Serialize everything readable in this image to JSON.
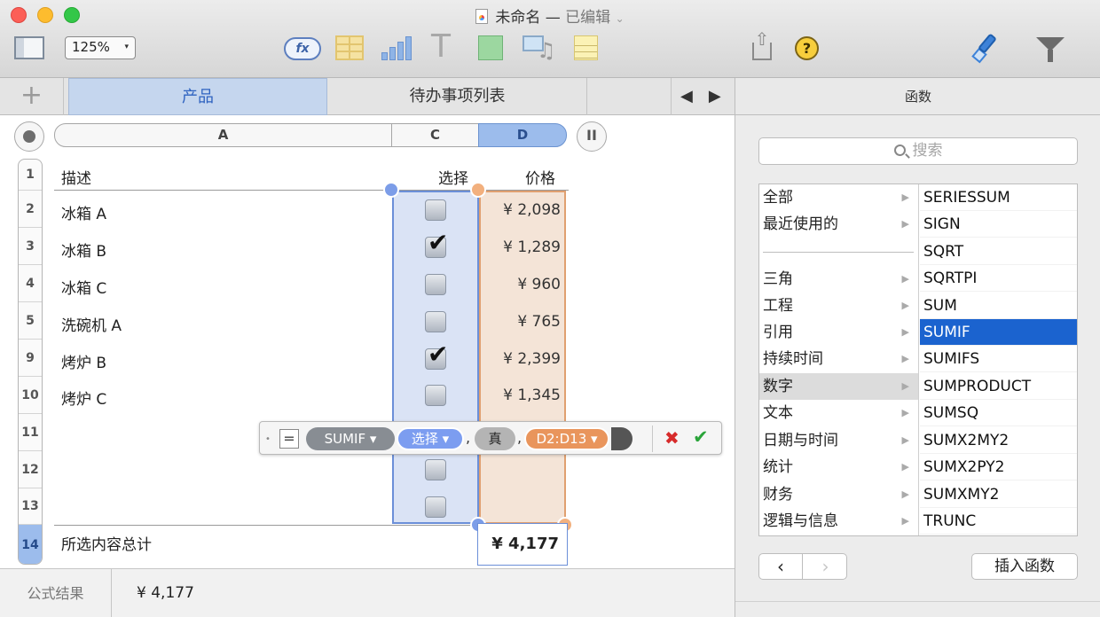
{
  "window": {
    "title": "未命名",
    "dash": "—",
    "edited": "已编辑",
    "edited_chevron": "⌄"
  },
  "toolbar": {
    "zoom": "125%",
    "zoom_arrow": "▾",
    "fx_label": "fx",
    "text_glyph": "T",
    "help_glyph": "?",
    "share_arrow": "⇧",
    "media_note": "♫"
  },
  "tabs": {
    "add": "+",
    "items": [
      "产品",
      "待办事项列表"
    ],
    "nav": "◀▶"
  },
  "columns": {
    "a": "A",
    "c": "C",
    "d": "D",
    "pause": "II"
  },
  "rows": {
    "numbers": [
      "1",
      "2",
      "3",
      "4",
      "5",
      "9",
      "10",
      "11",
      "12",
      "13",
      "14"
    ]
  },
  "table": {
    "header": {
      "desc": "描述",
      "select": "选择",
      "price": "价格"
    },
    "items": [
      {
        "desc": "冰箱 A",
        "checked": false,
        "price": "¥ 2,098"
      },
      {
        "desc": "冰箱 B",
        "checked": true,
        "price": "¥ 1,289"
      },
      {
        "desc": "冰箱 C",
        "checked": false,
        "price": "¥ 960"
      },
      {
        "desc": "洗碗机 A",
        "checked": false,
        "price": "¥ 765"
      },
      {
        "desc": "烤炉 B",
        "checked": true,
        "price": "¥ 2,399"
      },
      {
        "desc": "烤炉 C",
        "checked": false,
        "price": "¥ 1,345"
      }
    ],
    "check_glyph": "✔",
    "total_label": "所选内容总计",
    "total_value": "¥ 4,177"
  },
  "formula": {
    "dot": "•",
    "equals": "=",
    "function": "SUMIF ▾",
    "arg1": "选择 ▾",
    "arg2": "真",
    "arg3": "D2:D13 ▾",
    "comma": ",",
    "cancel": "✖",
    "accept": "✔"
  },
  "status": {
    "label": "公式结果",
    "value": "¥ 4,177"
  },
  "panel": {
    "title": "函数",
    "search_placeholder": "搜索",
    "categories": [
      "全部",
      "最近使用的",
      "三角",
      "工程",
      "引用",
      "持续时间",
      "数字",
      "文本",
      "日期与时间",
      "统计",
      "财务",
      "逻辑与信息"
    ],
    "selected_category": "数字",
    "functions": [
      "SERIESSUM",
      "SIGN",
      "SQRT",
      "SQRTPI",
      "SUM",
      "SUMIF",
      "SUMIFS",
      "SUMPRODUCT",
      "SUMSQ",
      "SUMX2MY2",
      "SUMX2PY2",
      "SUMXMY2",
      "TRUNC"
    ],
    "selected_function": "SUMIF",
    "arrow_glyph": "▶",
    "prev": "‹",
    "next": "›",
    "insert": "插入函数"
  },
  "colors": {
    "select_column": "#6b8fd8",
    "price_column": "#e0a070",
    "selection_blue": "#1b63cf"
  }
}
